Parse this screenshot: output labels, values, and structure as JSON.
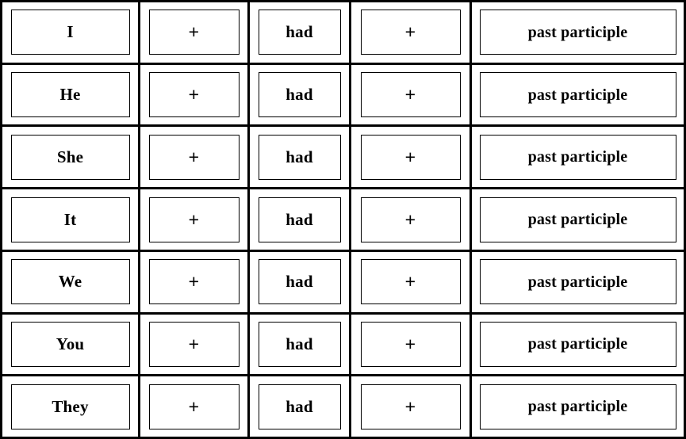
{
  "table": {
    "columns": [
      {
        "key": "subject",
        "name": "subject-pronoun"
      },
      {
        "key": "plus1",
        "name": "plus-operator-1"
      },
      {
        "key": "verb",
        "name": "auxiliary-verb"
      },
      {
        "key": "plus2",
        "name": "plus-operator-2"
      },
      {
        "key": "form",
        "name": "verb-form"
      }
    ],
    "plus_symbol": "+",
    "auxiliary": "had",
    "verb_form": "past participle",
    "rows": [
      {
        "subject": "I",
        "plus1": "+",
        "verb": "had",
        "plus2": "+",
        "form": "past participle"
      },
      {
        "subject": "He",
        "plus1": "+",
        "verb": "had",
        "plus2": "+",
        "form": "past participle"
      },
      {
        "subject": "She",
        "plus1": "+",
        "verb": "had",
        "plus2": "+",
        "form": "past participle"
      },
      {
        "subject": "It",
        "plus1": "+",
        "verb": "had",
        "plus2": "+",
        "form": "past participle"
      },
      {
        "subject": "We",
        "plus1": "+",
        "verb": "had",
        "plus2": "+",
        "form": "past participle"
      },
      {
        "subject": "You",
        "plus1": "+",
        "verb": "had",
        "plus2": "+",
        "form": "past participle"
      },
      {
        "subject": "They",
        "plus1": "+",
        "verb": "had",
        "plus2": "+",
        "form": "past participle"
      }
    ]
  },
  "colors": {
    "border": "#000000",
    "text": "#000000",
    "background": "#ffffff"
  }
}
